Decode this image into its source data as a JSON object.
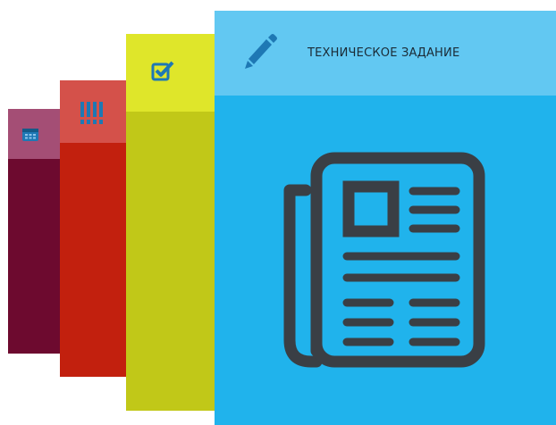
{
  "colors": {
    "calendar_head": "#a44e75",
    "calendar_body": "#6d0a2f",
    "priority_head": "#d4514a",
    "priority_body": "#c2200e",
    "tasks_head": "#dfe62a",
    "tasks_body": "#c1c818",
    "spec_head": "#62c8f2",
    "spec_body": "#20b3ec",
    "icon_dark": "#3a3f45",
    "icon_blue": "#1e78b4"
  },
  "cards": [
    {
      "id": "calendar",
      "icon": "calendar-icon"
    },
    {
      "id": "priority",
      "icon": "exclamation-marks-icon"
    },
    {
      "id": "tasks",
      "icon": "checkbox-checked-icon"
    },
    {
      "id": "spec",
      "icon": "pencil-icon",
      "title": "ТЕХНИЧЕСКОЕ ЗАДАНИЕ",
      "illustration": "newspaper-icon"
    }
  ]
}
